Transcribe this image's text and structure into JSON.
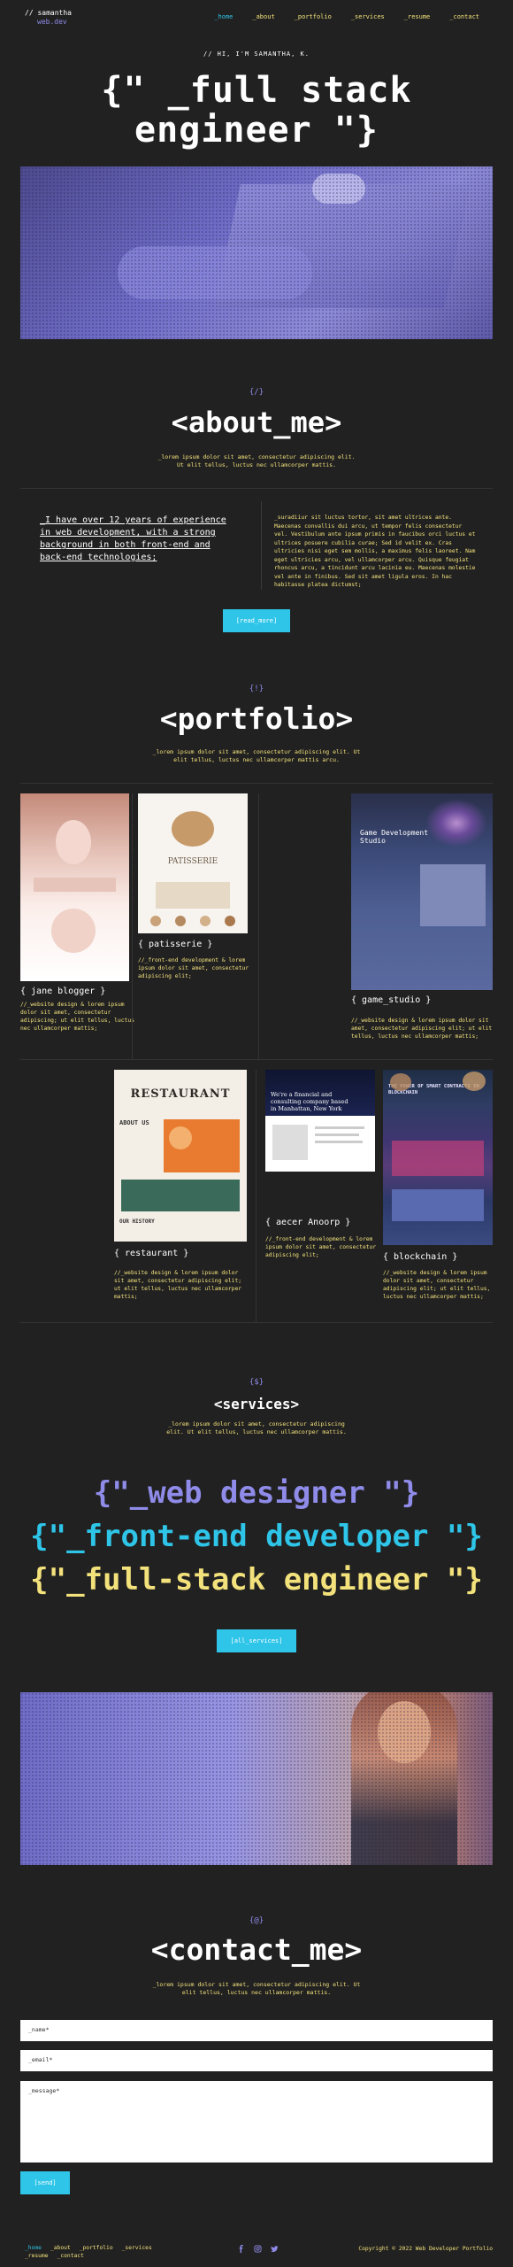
{
  "header": {
    "logo_line1": "// samantha",
    "logo_line2": "web.dev",
    "nav": [
      "_home",
      "_about",
      "_portfolio",
      "_services",
      "_resume",
      "_contact"
    ]
  },
  "hero": {
    "greeting": "// HI, I'M SAMANTHA, K.",
    "title_line1": "{\" _full stack",
    "title_line2": "engineer \"}"
  },
  "about": {
    "tag": "{/}",
    "title": "<about_me>",
    "subtitle": "_lorem ipsum dolor sit amet, consectetur adipiscing elit.\nUt elit tellus, luctus nec ullamcorper mattis.",
    "lead": "_I have over 12 years of experience in web development, with a strong background in both front-end and back-end technologies;",
    "body": "_suradiiur sit luctus tortor, sit amet ultrices ante. Maecenas convallis dui arcu, ut tempor felis consectetur vel. Vestibulum ante ipsum primis in faucibus orci luctus et ultrices posuere cubilia curae; Sed id velit ex. Cras ultricies nisi eget sem mollis, a maximus felis laoreet. Nam eget ultricies arcu, vel ullamcorper arcu. Quisque feugiat rhoncus arcu, a tincidunt arcu lacinia eu. Maecenas molestie vel ante in finibus. Sed sit amet ligula eros. In hac habitasse platea dictumst;",
    "button": "[read_more]"
  },
  "portfolio": {
    "tag": "{!}",
    "title": "<portfolio>",
    "subtitle": "_lorem ipsum dolor sit amet, consectetur adipiscing elit. Ut\nelit tellus, luctus nec ullamcorper mattis arcu.",
    "items": [
      {
        "name": "{ jane blogger }",
        "desc": "//_website design & lorem ipsum dolor sit amet, consectetur adipiscing; ut elit tellus, luctus nec ullamcorper mattis;"
      },
      {
        "name": "{ patisserie }",
        "desc": "//_front-end development & lorem ipsum dolor sit amet, consectetur adipiscing elit;"
      },
      {
        "name": "{ game_studio }",
        "desc": "//_website design & lorem ipsum dolor sit amet, consectetur adipiscing elit; ut elit tellus, luctus nec ullamcorper mattis;"
      },
      {
        "name": "{ restaurant }",
        "desc": "//_website design & lorem ipsum dolor sit amet, consectetur adipiscing elit; ut elit tellus, luctus nec ullamcorper mattis;"
      },
      {
        "name": "{ aecer Anoorp }",
        "desc": "//_front-end development & lorem ipsum dolor sit amet, consectetur adipiscing elit;"
      },
      {
        "name": "{ blockchain }",
        "desc": "//_website design & lorem ipsum dolor sit amet, consectetur adipiscing elit; ut elit tellus, luctus nec ullamcorper mattis;"
      }
    ],
    "shot_texts": {
      "patisserie": "PATISSERIE",
      "game": "Game Development Studio",
      "restaurant": "RESTAURANT",
      "restaurant_about": "ABOUT US",
      "restaurant_history": "OUR HISTORY",
      "consult": "We're a financial and consulting company based in Manhattan, New York",
      "blockchain": "THE POWER OF SMART CONTRACTS IN BLOCKCHAIN"
    }
  },
  "services": {
    "tag": "{$}",
    "title": "<services>",
    "subtitle": "_lorem ipsum dolor sit amet, consectetur adipiscing\nelit. Ut elit tellus, luctus nec ullamcorper mattis.",
    "lines": [
      "{\"_web designer \"}",
      "{\"_front-end developer \"}",
      "{\"_full-stack engineer \"}"
    ],
    "button": "[all_services]"
  },
  "contact": {
    "tag": "{@}",
    "title": "<contact_me>",
    "subtitle": "_lorem ipsum dolor sit amet, consectetur adipiscing elit. Ut\nelit tellus, luctus nec ullamcorper mattis.",
    "name_placeholder": "_name*",
    "email_placeholder": "_email*",
    "message_placeholder": "_message*",
    "button": "[send]"
  },
  "footer": {
    "nav": [
      "_home",
      "_about",
      "_portfolio",
      "_services",
      "_resume",
      "_contact"
    ],
    "social": [
      "facebook-icon",
      "instagram-icon",
      "twitter-icon"
    ],
    "copyright": "Copyright © 2022 Web Developer Portfolio"
  },
  "colors": {
    "background": "#212121",
    "accent": "#2ec5e8",
    "yellow": "#f3e27c",
    "purple": "#8f8be8"
  }
}
